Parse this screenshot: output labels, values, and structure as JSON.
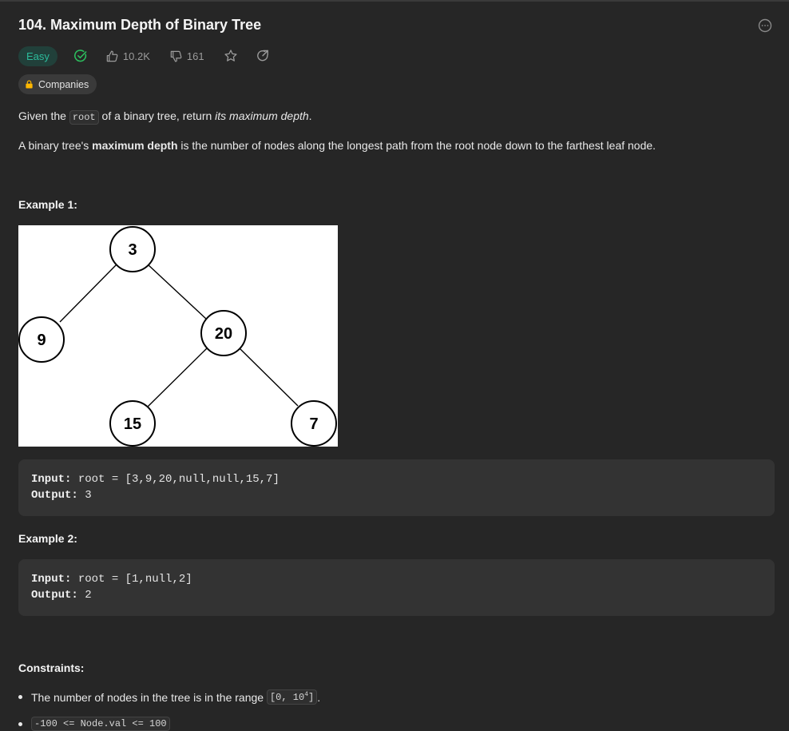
{
  "problem": {
    "title": "104. Maximum Depth of Binary Tree",
    "difficulty": "Easy",
    "likes": "10.2K",
    "dislikes": "161",
    "companies_label": "Companies"
  },
  "description": {
    "p1_prefix": "Given the ",
    "p1_code": "root",
    "p1_middle": " of a binary tree, return ",
    "p1_em": "its maximum depth",
    "p1_suffix": ".",
    "p2_prefix": "A binary tree's ",
    "p2_bold": "maximum depth",
    "p2_suffix": " is the number of nodes along the longest path from the root node down to the farthest leaf node."
  },
  "example1": {
    "heading": "Example 1:",
    "input_label": "Input:",
    "input_value": " root = [3,9,20,null,null,15,7]",
    "output_label": "Output:",
    "output_value": " 3",
    "tree_nodes": [
      "3",
      "9",
      "20",
      "15",
      "7"
    ]
  },
  "example2": {
    "heading": "Example 2:",
    "input_label": "Input:",
    "input_value": " root = [1,null,2]",
    "output_label": "Output:",
    "output_value": " 2"
  },
  "constraints": {
    "heading": "Constraints:",
    "c1_prefix": "The number of nodes in the tree is in the range ",
    "c1_code_a": "[0, 10",
    "c1_code_sup": "4",
    "c1_code_b": "]",
    "c1_suffix": ".",
    "c2_code": "-100 <= Node.val <= 100"
  },
  "colors": {
    "background": "#262626",
    "easy_badge_text": "#2cbb9b",
    "solved_check": "#2cbb5d",
    "lock": "#ffb800"
  },
  "icons": [
    "more-icon",
    "solved-check-icon",
    "thumbs-up-icon",
    "thumbs-down-icon",
    "star-icon",
    "share-icon",
    "lock-icon"
  ]
}
